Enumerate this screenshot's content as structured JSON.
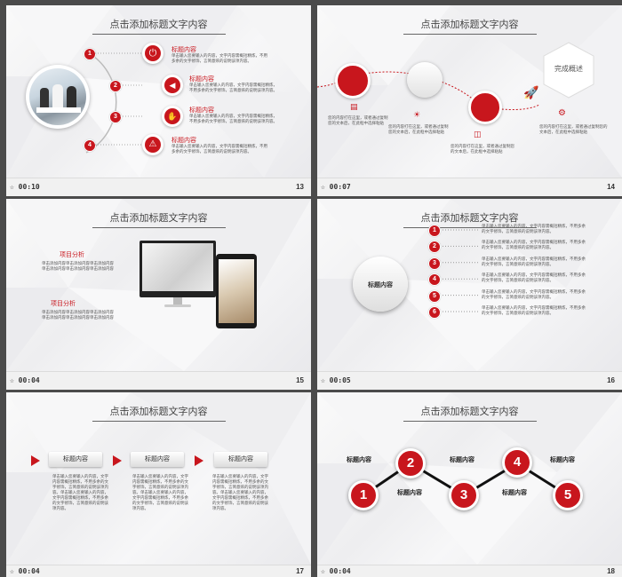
{
  "slides": [
    {
      "number": "13",
      "time": "00:10",
      "title": "点击添加标题文字内容",
      "items": [
        {
          "n": "1",
          "label": "标题内容",
          "text": "单击输入您要输入的内容，文字内容需概括精炼，不用多余的文字修饰，言简意赅的说明该项内容。"
        },
        {
          "n": "2",
          "label": "标题内容",
          "text": "单击输入您要输入的内容，文字内容需概括精炼，不用多余的文字修饰，言简意赅的说明该项内容。"
        },
        {
          "n": "3",
          "label": "标题内容",
          "text": "单击输入您要输入的内容，文字内容需概括精炼，不用多余的文字修饰，言简意赅的说明该项内容。"
        },
        {
          "n": "4",
          "label": "标题内容",
          "text": "单击输入您要输入的内容，文字内容需概括精炼，不用多余的文字修饰，言简意赅的说明该项内容。"
        }
      ]
    },
    {
      "number": "14",
      "time": "00:07",
      "title": "点击添加标题文字内容",
      "badge": "完成概述",
      "texts": [
        "您的内容打在这里，或者通过复制您的文本后，在此框中选择粘贴",
        "您的内容打在这里，或者通过复制您的文本后，在此框中选择粘贴",
        "您的内容打在这里，或者通过复制您的文本后，在此框中选择粘贴",
        "您的内容打在这里，或者通过复制您的文本后，在此框中选择粘贴"
      ]
    },
    {
      "number": "15",
      "time": "00:04",
      "title": "点击添加标题文字内容",
      "sections": [
        {
          "label": "项目分析",
          "text": "单击添加内容单击添加内容单击添加内容单击添加内容单击添加内容单击添加内容"
        },
        {
          "label": "项目分析",
          "text": "单击添加内容单击添加内容单击添加内容单击添加内容单击添加内容单击添加内容"
        }
      ]
    },
    {
      "number": "16",
      "time": "00:05",
      "title": "点击添加标题文字内容",
      "center": "标题内容",
      "rows": [
        {
          "n": "1",
          "text": "单击输入您要输入的内容，文字内容需概括精炼，不用多余的文字修饰，言简意赅的说明该项内容。"
        },
        {
          "n": "2",
          "text": "单击输入您要输入的内容，文字内容需概括精炼，不用多余的文字修饰，言简意赅的说明该项内容。"
        },
        {
          "n": "3",
          "text": "单击输入您要输入的内容，文字内容需概括精炼，不用多余的文字修饰，言简意赅的说明该项内容。"
        },
        {
          "n": "4",
          "text": "单击输入您要输入的内容，文字内容需概括精炼，不用多余的文字修饰，言简意赅的说明该项内容。"
        },
        {
          "n": "5",
          "text": "单击输入您要输入的内容，文字内容需概括精炼，不用多余的文字修饰，言简意赅的说明该项内容。"
        },
        {
          "n": "6",
          "text": "单击输入您要输入的内容，文字内容需概括精炼，不用多余的文字修饰，言简意赅的说明该项内容。"
        }
      ]
    },
    {
      "number": "17",
      "time": "00:04",
      "title": "点击添加标题文字内容",
      "cols": [
        {
          "label": "标题内容",
          "text": "单击输入您要输入的内容，文字内容需概括精炼，不用多余的文字修饰，言简意赅的说明该项内容。单击输入您要输入的内容，文字内容需概括精炼，不用多余的文字修饰，言简意赅的说明该项内容。"
        },
        {
          "label": "标题内容",
          "text": "单击输入您要输入的内容，文字内容需概括精炼，不用多余的文字修饰，言简意赅的说明该项内容。单击输入您要输入的内容，文字内容需概括精炼，不用多余的文字修饰，言简意赅的说明该项内容。"
        },
        {
          "label": "标题内容",
          "text": "单击输入您要输入的内容，文字内容需概括精炼，不用多余的文字修饰，言简意赅的说明该项内容。单击输入您要输入的内容，文字内容需概括精炼，不用多余的文字修饰，言简意赅的说明该项内容。"
        }
      ]
    },
    {
      "number": "18",
      "time": "00:04",
      "title": "点击添加标题文字内容",
      "steps": [
        {
          "n": "1",
          "label": "标题内容"
        },
        {
          "n": "2",
          "label": "标题内容"
        },
        {
          "n": "3",
          "label": "标题内容"
        },
        {
          "n": "4",
          "label": "标题内容"
        },
        {
          "n": "5",
          "label": "标题内容"
        }
      ]
    }
  ],
  "colors": {
    "accent": "#c8161d",
    "background": "#4b4b4b"
  }
}
